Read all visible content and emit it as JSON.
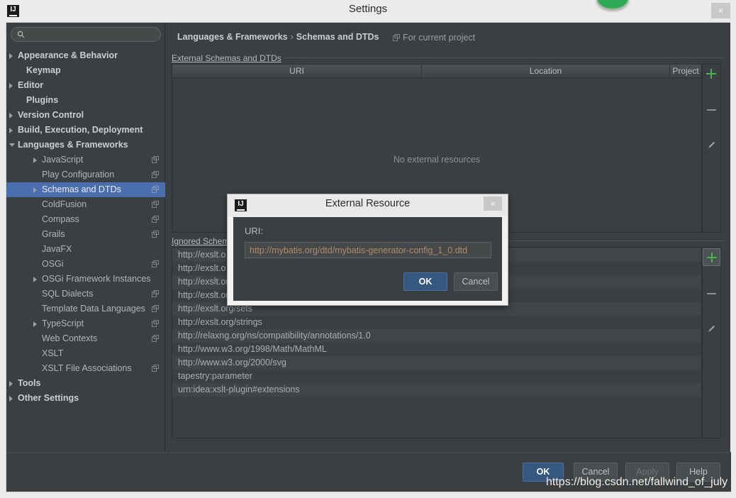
{
  "window": {
    "title": "Settings",
    "logo_text": "I",
    "close_label": "×"
  },
  "sidebar": {
    "search": {
      "value": "",
      "placeholder": "",
      "icon": "search-icon"
    },
    "items": [
      {
        "label": "Appearance & Behavior",
        "indent": 16,
        "arrow": "closed",
        "bold": true,
        "copy": false,
        "selected": false
      },
      {
        "label": "Keymap",
        "indent": 28,
        "arrow": "none",
        "bold": true,
        "copy": false,
        "selected": false
      },
      {
        "label": "Editor",
        "indent": 16,
        "arrow": "closed",
        "bold": true,
        "copy": false,
        "selected": false
      },
      {
        "label": "Plugins",
        "indent": 28,
        "arrow": "none",
        "bold": true,
        "copy": false,
        "selected": false
      },
      {
        "label": "Version Control",
        "indent": 16,
        "arrow": "closed",
        "bold": true,
        "copy": false,
        "selected": false
      },
      {
        "label": "Build, Execution, Deployment",
        "indent": 16,
        "arrow": "closed",
        "bold": true,
        "copy": false,
        "selected": false
      },
      {
        "label": "Languages & Frameworks",
        "indent": 16,
        "arrow": "open",
        "bold": true,
        "copy": false,
        "selected": false
      },
      {
        "label": "JavaScript",
        "indent": 50,
        "arrow": "closed",
        "bold": false,
        "copy": true,
        "selected": false
      },
      {
        "label": "Play Configuration",
        "indent": 50,
        "arrow": "none",
        "bold": false,
        "copy": true,
        "selected": false
      },
      {
        "label": "Schemas and DTDs",
        "indent": 50,
        "arrow": "closed",
        "bold": false,
        "copy": true,
        "selected": true
      },
      {
        "label": "ColdFusion",
        "indent": 50,
        "arrow": "none",
        "bold": false,
        "copy": true,
        "selected": false
      },
      {
        "label": "Compass",
        "indent": 50,
        "arrow": "none",
        "bold": false,
        "copy": true,
        "selected": false
      },
      {
        "label": "Grails",
        "indent": 50,
        "arrow": "none",
        "bold": false,
        "copy": true,
        "selected": false
      },
      {
        "label": "JavaFX",
        "indent": 50,
        "arrow": "none",
        "bold": false,
        "copy": false,
        "selected": false
      },
      {
        "label": "OSGi",
        "indent": 50,
        "arrow": "none",
        "bold": false,
        "copy": true,
        "selected": false
      },
      {
        "label": "OSGi Framework Instances",
        "indent": 50,
        "arrow": "closed",
        "bold": false,
        "copy": false,
        "selected": false
      },
      {
        "label": "SQL Dialects",
        "indent": 50,
        "arrow": "none",
        "bold": false,
        "copy": true,
        "selected": false
      },
      {
        "label": "Template Data Languages",
        "indent": 50,
        "arrow": "none",
        "bold": false,
        "copy": true,
        "selected": false
      },
      {
        "label": "TypeScript",
        "indent": 50,
        "arrow": "closed",
        "bold": false,
        "copy": true,
        "selected": false
      },
      {
        "label": "Web Contexts",
        "indent": 50,
        "arrow": "none",
        "bold": false,
        "copy": true,
        "selected": false
      },
      {
        "label": "XSLT",
        "indent": 50,
        "arrow": "none",
        "bold": false,
        "copy": false,
        "selected": false
      },
      {
        "label": "XSLT File Associations",
        "indent": 50,
        "arrow": "none",
        "bold": false,
        "copy": true,
        "selected": false
      },
      {
        "label": "Tools",
        "indent": 16,
        "arrow": "closed",
        "bold": true,
        "copy": false,
        "selected": false
      },
      {
        "label": "Other Settings",
        "indent": 16,
        "arrow": "closed",
        "bold": true,
        "copy": false,
        "selected": false
      }
    ]
  },
  "content": {
    "breadcrumb": {
      "parent": "Languages & Frameworks",
      "separator": "›",
      "current": "Schemas and DTDs"
    },
    "for_current_project": "For current project",
    "external": {
      "group_title": "External Schemas and DTDs",
      "columns": [
        "URI",
        "Location",
        "Project"
      ],
      "rows": [],
      "empty_message": "No external resources",
      "buttons": [
        "add",
        "remove",
        "edit"
      ]
    },
    "ignored": {
      "group_title": "Ignored Schemas and DTDs",
      "rows": [
        "http://exslt.o",
        "http://exslt.o",
        "http://exslt.org/dynamic",
        "http://exslt.org/math",
        "http://exslt.org/sets",
        "http://exslt.org/strings",
        "http://relaxng.org/ns/compatibility/annotations/1.0",
        "http://www.w3.org/1998/Math/MathML",
        "http://www.w3.org/2000/svg",
        "tapestry:parameter",
        "urn:idea:xslt-plugin#extensions"
      ],
      "buttons": [
        "add",
        "remove",
        "edit"
      ]
    }
  },
  "footer": {
    "ok": "OK",
    "cancel": "Cancel",
    "apply": "Apply",
    "help": "Help"
  },
  "dialog": {
    "title": "External Resource",
    "close_label": "×",
    "uri_label": "URI:",
    "uri_value": "http://mybatis.org/dtd/mybatis-generator-config_1_0.dtd",
    "uri_placeholder": "",
    "ok": "OK",
    "cancel": "Cancel"
  },
  "watermark": "https://blog.csdn.net/fallwind_of_july",
  "colors": {
    "panel_bg": "#3c3f41",
    "selection_blue": "#4b6eaf",
    "primary_button": "#365880",
    "accent_green": "#4caf50",
    "badge_green": "#2eaa55",
    "field_text_orange": "#b08a6a"
  }
}
